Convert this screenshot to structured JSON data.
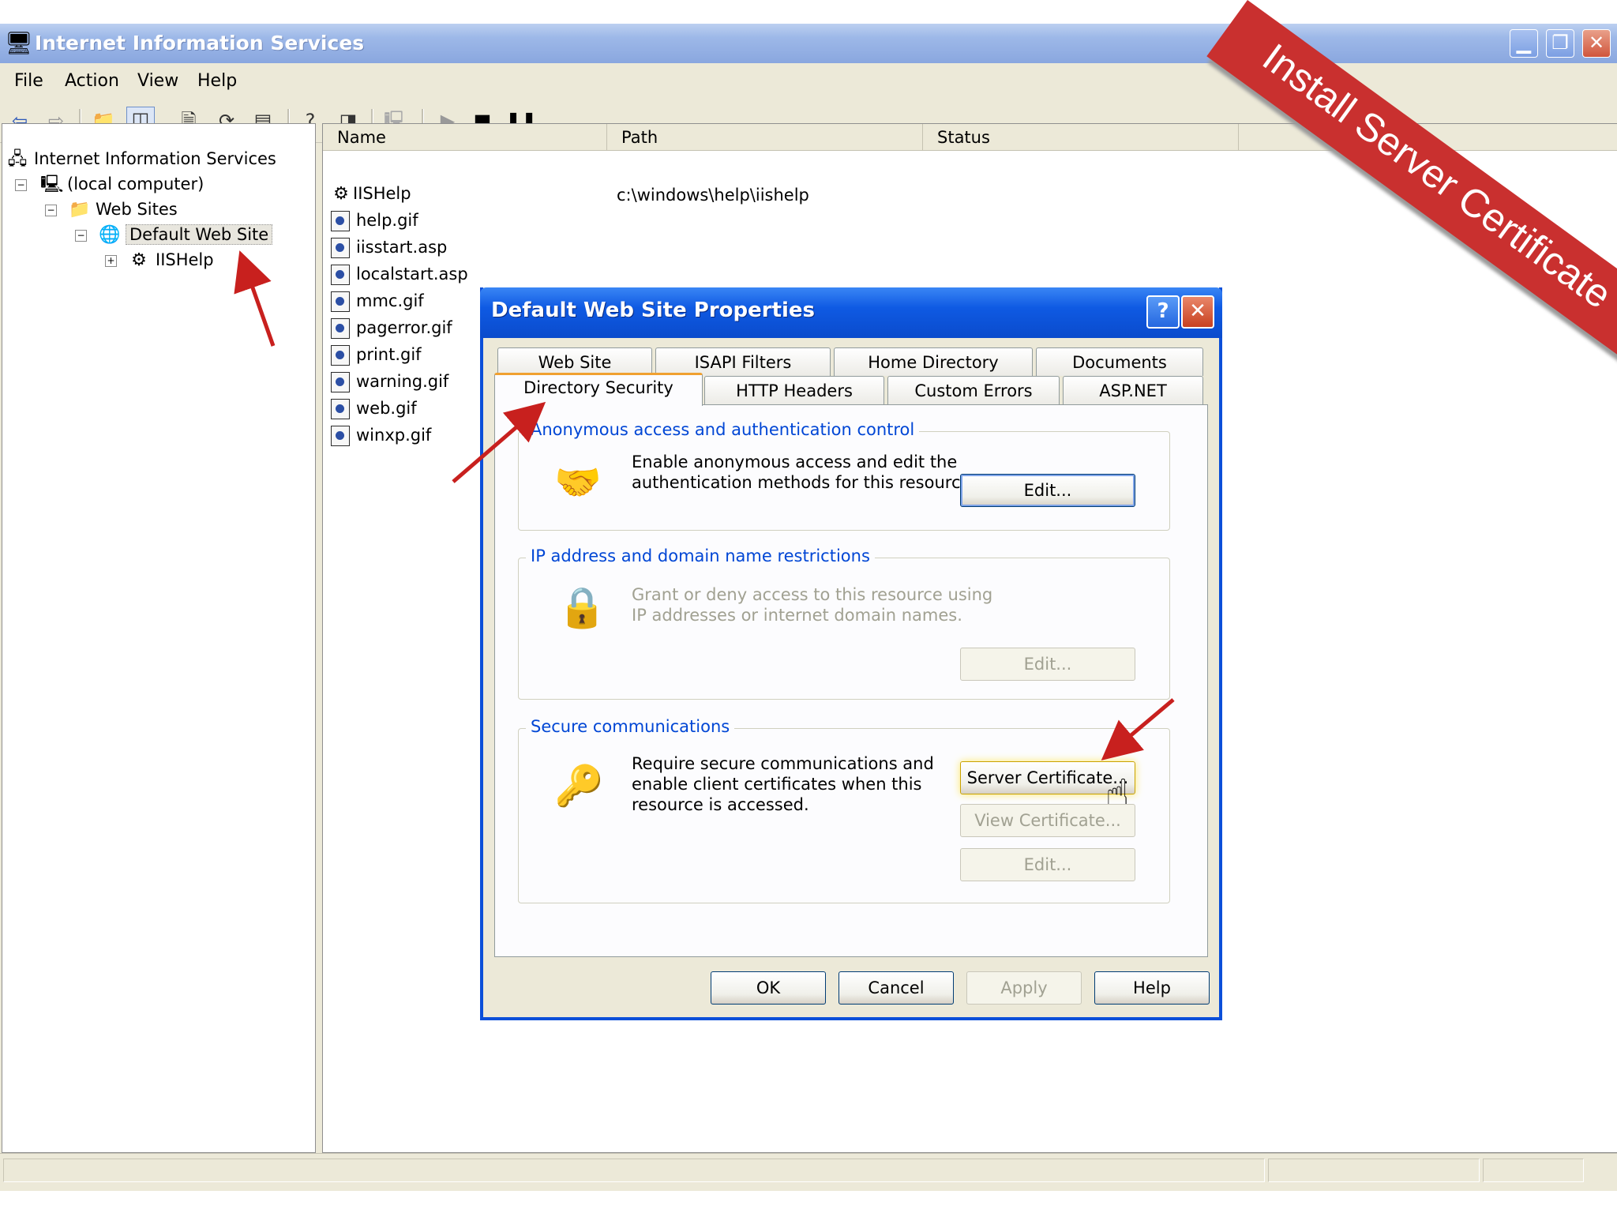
{
  "window": {
    "title": "Internet Information Services"
  },
  "menu": [
    "File",
    "Action",
    "View",
    "Help"
  ],
  "tree": {
    "root": "Internet Information Services",
    "computer": "(local computer)",
    "web_sites": "Web Sites",
    "default_site": "Default Web Site",
    "iishelp": "IISHelp"
  },
  "list": {
    "columns": [
      "Name",
      "Path",
      "Status"
    ],
    "rows": [
      {
        "name": "IISHelp",
        "path": "c:\\windows\\help\\iishelp"
      },
      {
        "name": "help.gif",
        "path": ""
      },
      {
        "name": "iisstart.asp",
        "path": ""
      },
      {
        "name": "localstart.asp",
        "path": ""
      },
      {
        "name": "mmc.gif",
        "path": ""
      },
      {
        "name": "pagerror.gif",
        "path": ""
      },
      {
        "name": "print.gif",
        "path": ""
      },
      {
        "name": "warning.gif",
        "path": ""
      },
      {
        "name": "web.gif",
        "path": ""
      },
      {
        "name": "winxp.gif",
        "path": ""
      }
    ]
  },
  "dialog": {
    "title": "Default Web Site Properties",
    "help_glyph": "?",
    "close_glyph": "✕",
    "tabs_row1": [
      "Web Site",
      "ISAPI Filters",
      "Home Directory",
      "Documents"
    ],
    "tabs_row2": [
      "Directory Security",
      "HTTP Headers",
      "Custom Errors",
      "ASP.NET"
    ],
    "anon": {
      "label": "Anonymous access and authentication control",
      "text1": "Enable anonymous access and edit the",
      "text2": "authentication methods for this resource.",
      "edit": "Edit..."
    },
    "ip": {
      "label": "IP address and domain name restrictions",
      "text1": "Grant or deny access to this resource using",
      "text2": "IP addresses or internet domain names.",
      "edit": "Edit..."
    },
    "secure": {
      "label": "Secure communications",
      "text1": "Require secure communications and",
      "text2": "enable client certificates when this",
      "text3": "resource is accessed.",
      "server_cert": "Server Certificate...",
      "view_cert": "View Certificate...",
      "edit": "Edit..."
    },
    "buttons": {
      "ok": "OK",
      "cancel": "Cancel",
      "apply": "Apply",
      "help": "Help"
    }
  },
  "banner": "Install Server Certificate",
  "colors": {
    "dialog_title": "#0b4fd9",
    "banner": "#c9302f",
    "arrow": "#c8201e",
    "group_label": "#0046d5"
  }
}
